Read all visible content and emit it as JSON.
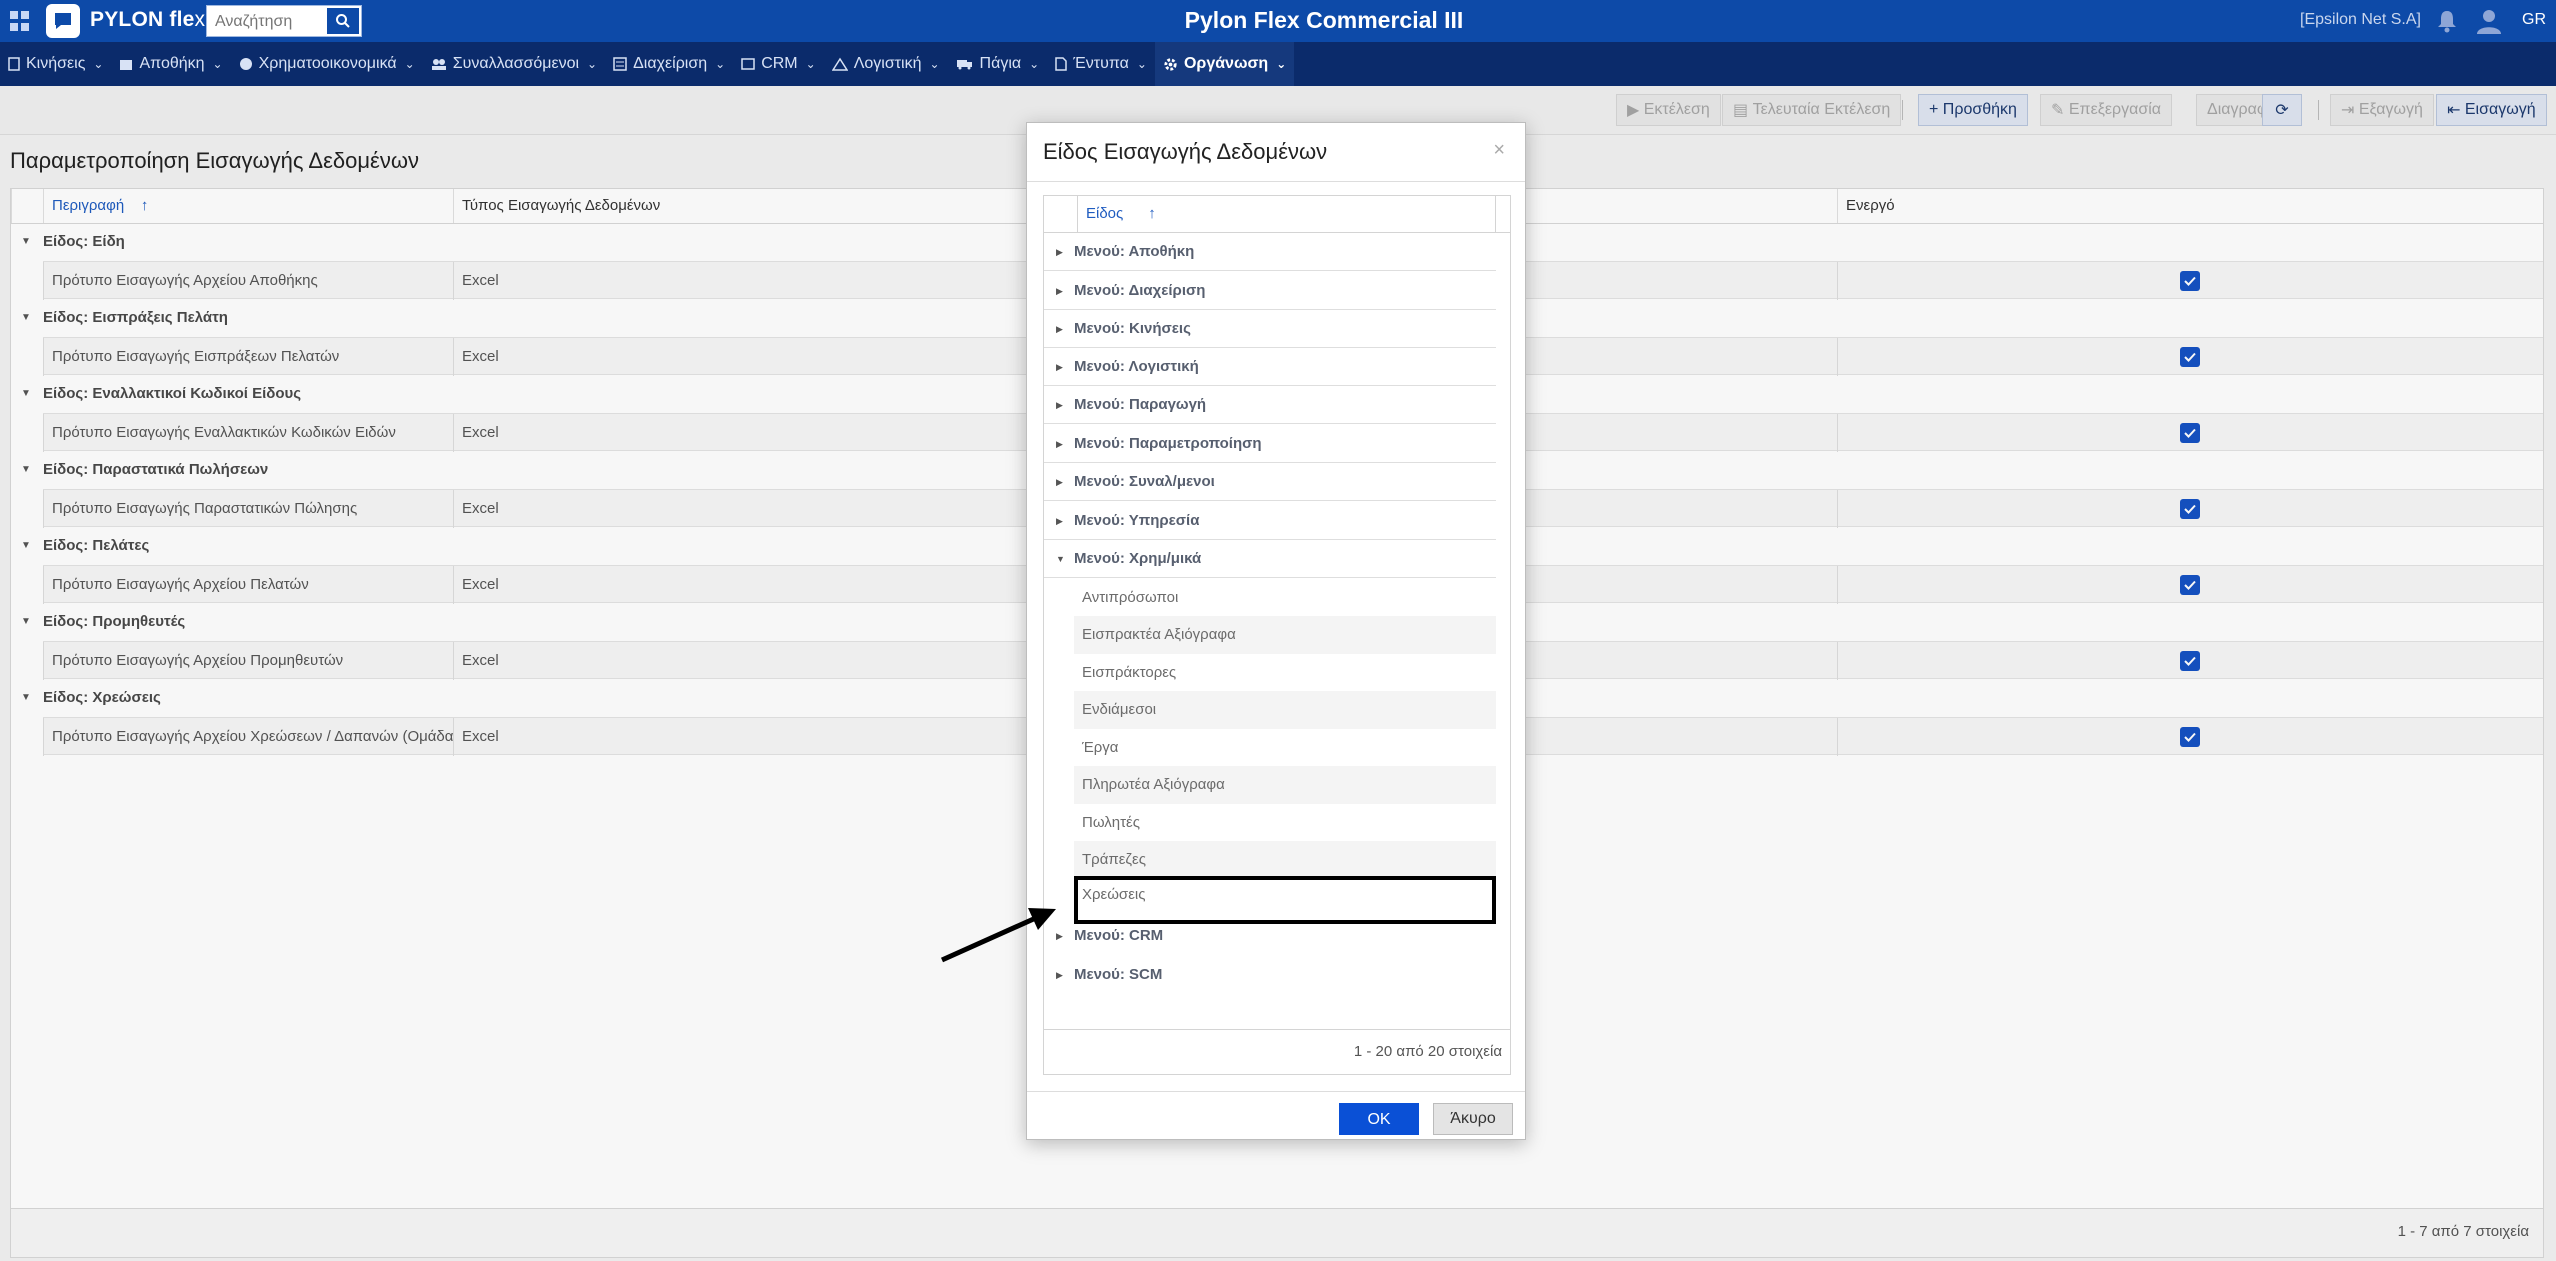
{
  "topbar": {
    "logo_main": "PYLON fle",
    "logo_x": "x",
    "search_placeholder": "Αναζήτηση",
    "app_title": "Pylon Flex Commercial III",
    "company": "[Epsilon Net S.A]",
    "language": "GR"
  },
  "menu": [
    {
      "label": "Κινήσεις",
      "icon": "movements-icon"
    },
    {
      "label": "Αποθήκη",
      "icon": "warehouse-icon"
    },
    {
      "label": "Χρηματοοικονομικά",
      "icon": "finance-icon"
    },
    {
      "label": "Συναλλασσόμενοι",
      "icon": "partners-icon"
    },
    {
      "label": "Διαχείριση",
      "icon": "management-icon"
    },
    {
      "label": "CRM",
      "icon": "crm-icon"
    },
    {
      "label": "Λογιστική",
      "icon": "accounting-icon"
    },
    {
      "label": "Πάγια",
      "icon": "truck-icon"
    },
    {
      "label": "Έντυπα",
      "icon": "document-icon"
    },
    {
      "label": "Οργάνωση",
      "icon": "gear-icon",
      "active": true
    }
  ],
  "toolbar": {
    "execute": "Εκτέλεση",
    "last_execute": "Τελευταία Εκτέλεση",
    "add": "Προσθήκη",
    "edit": "Επεξεργασία",
    "delete": "Διαγραφή",
    "export": "Εξαγωγή",
    "import": "Εισαγωγή"
  },
  "page": {
    "title": "Παραμετροποίηση Εισαγωγής Δεδομένων",
    "columns": [
      "Περιγραφή",
      "Τύπος Εισαγωγής Δεδομένων",
      "Ενεργό"
    ],
    "groups": [
      {
        "label": "Είδος: Είδη",
        "row": {
          "desc": "Πρότυπο Εισαγωγής Αρχείου Αποθήκης",
          "type": "Excel",
          "active": true
        }
      },
      {
        "label": "Είδος: Εισπράξεις Πελάτη",
        "row": {
          "desc": "Πρότυπο Εισαγωγής Εισπράξεων Πελατών",
          "type": "Excel",
          "active": true
        }
      },
      {
        "label": "Είδος: Εναλλακτικοί Κωδικοί Είδους",
        "row": {
          "desc": "Πρότυπο Εισαγωγής Εναλλακτικών Κωδικών Ειδών",
          "type": "Excel",
          "active": true
        }
      },
      {
        "label": "Είδος: Παραστατικά Πωλήσεων",
        "row": {
          "desc": "Πρότυπο Εισαγωγής Παραστατικών Πώλησης",
          "type": "Excel",
          "active": true
        }
      },
      {
        "label": "Είδος: Πελάτες",
        "row": {
          "desc": "Πρότυπο Εισαγωγής Αρχείου Πελατών",
          "type": "Excel",
          "active": true
        }
      },
      {
        "label": "Είδος: Προμηθευτές",
        "row": {
          "desc": "Πρότυπο Εισαγωγής Αρχείου Προμηθευτών",
          "type": "Excel",
          "active": true
        }
      },
      {
        "label": "Είδος: Χρεώσεις",
        "row": {
          "desc": "Πρότυπο Εισαγωγής Αρχείου Χρεώσεων / Δαπανών (Ομάδα (",
          "type": "Excel",
          "active": true
        }
      }
    ],
    "footer": "1 - 7 από 7 στοιχεία"
  },
  "modal": {
    "title": "Είδος Εισαγωγής Δεδομένων",
    "close": "×",
    "column": "Είδος",
    "nodes_before": [
      "Μενού: Αποθήκη",
      "Μενού: Διαχείριση",
      "Μενού: Κινήσεις",
      "Μενού: Λογιστική",
      "Μενού: Παραγωγή",
      "Μενού: Παραμετροποίηση",
      "Μενού: Συναλ/μενοι",
      "Μενού: Υπηρεσία",
      "Μενού: Χρημ/μικά"
    ],
    "children": [
      "Αντιπρόσωποι",
      "Εισπρακτέα Αξιόγραφα",
      "Εισπράκτορες",
      "Ενδιάμεσοι",
      "Έργα",
      "Πληρωτέα Αξιόγραφα",
      "Πωλητές",
      "Τράπεζες",
      "Χρεώσεις"
    ],
    "nodes_after": [
      "Μενού: CRM",
      "Μενού: SCM"
    ],
    "footer": "1 - 20 από 20 στοιχεία",
    "ok": "OK",
    "cancel": "Άκυρο"
  }
}
